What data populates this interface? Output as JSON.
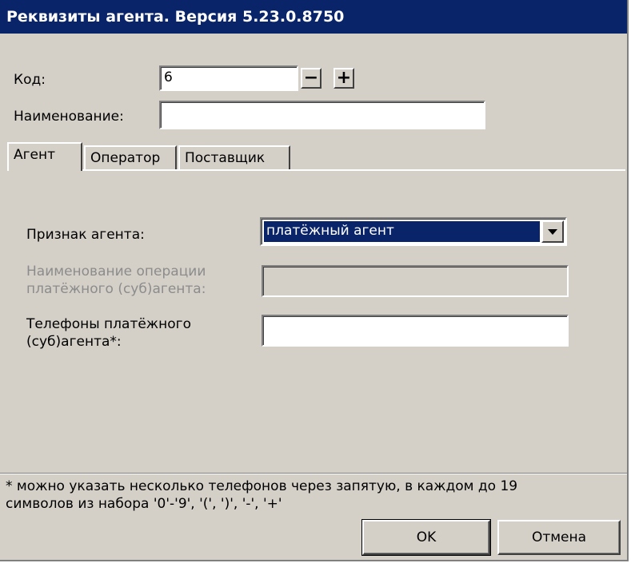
{
  "window": {
    "title": "Реквизиты агента. Версия 5.23.0.8750"
  },
  "form": {
    "code_label": "Код:",
    "code_value": "6",
    "name_label": "Наименование:",
    "name_value": ""
  },
  "spin": {
    "minus": "−",
    "plus": "+"
  },
  "tabs": [
    {
      "label": "Агент",
      "active": true
    },
    {
      "label": "Оператор",
      "active": false
    },
    {
      "label": "Поставщик",
      "active": false
    }
  ],
  "agent_tab": {
    "sign_label": "Признак агента:",
    "sign_value": "платёжный агент",
    "operation_label_1": "Наименование операции",
    "operation_label_2": "платёжного (суб)агента:",
    "operation_value": "",
    "phones_label_1": "Телефоны платёжного",
    "phones_label_2": "(суб)агента*:",
    "phones_value": ""
  },
  "note": {
    "line1": "*   можно указать несколько телефонов через запятую, в каждом до 19",
    "line2": "символов из набора '0'-'9', '(', ')', '-', '+'"
  },
  "buttons": {
    "ok": "OK",
    "cancel": "Отмена"
  }
}
